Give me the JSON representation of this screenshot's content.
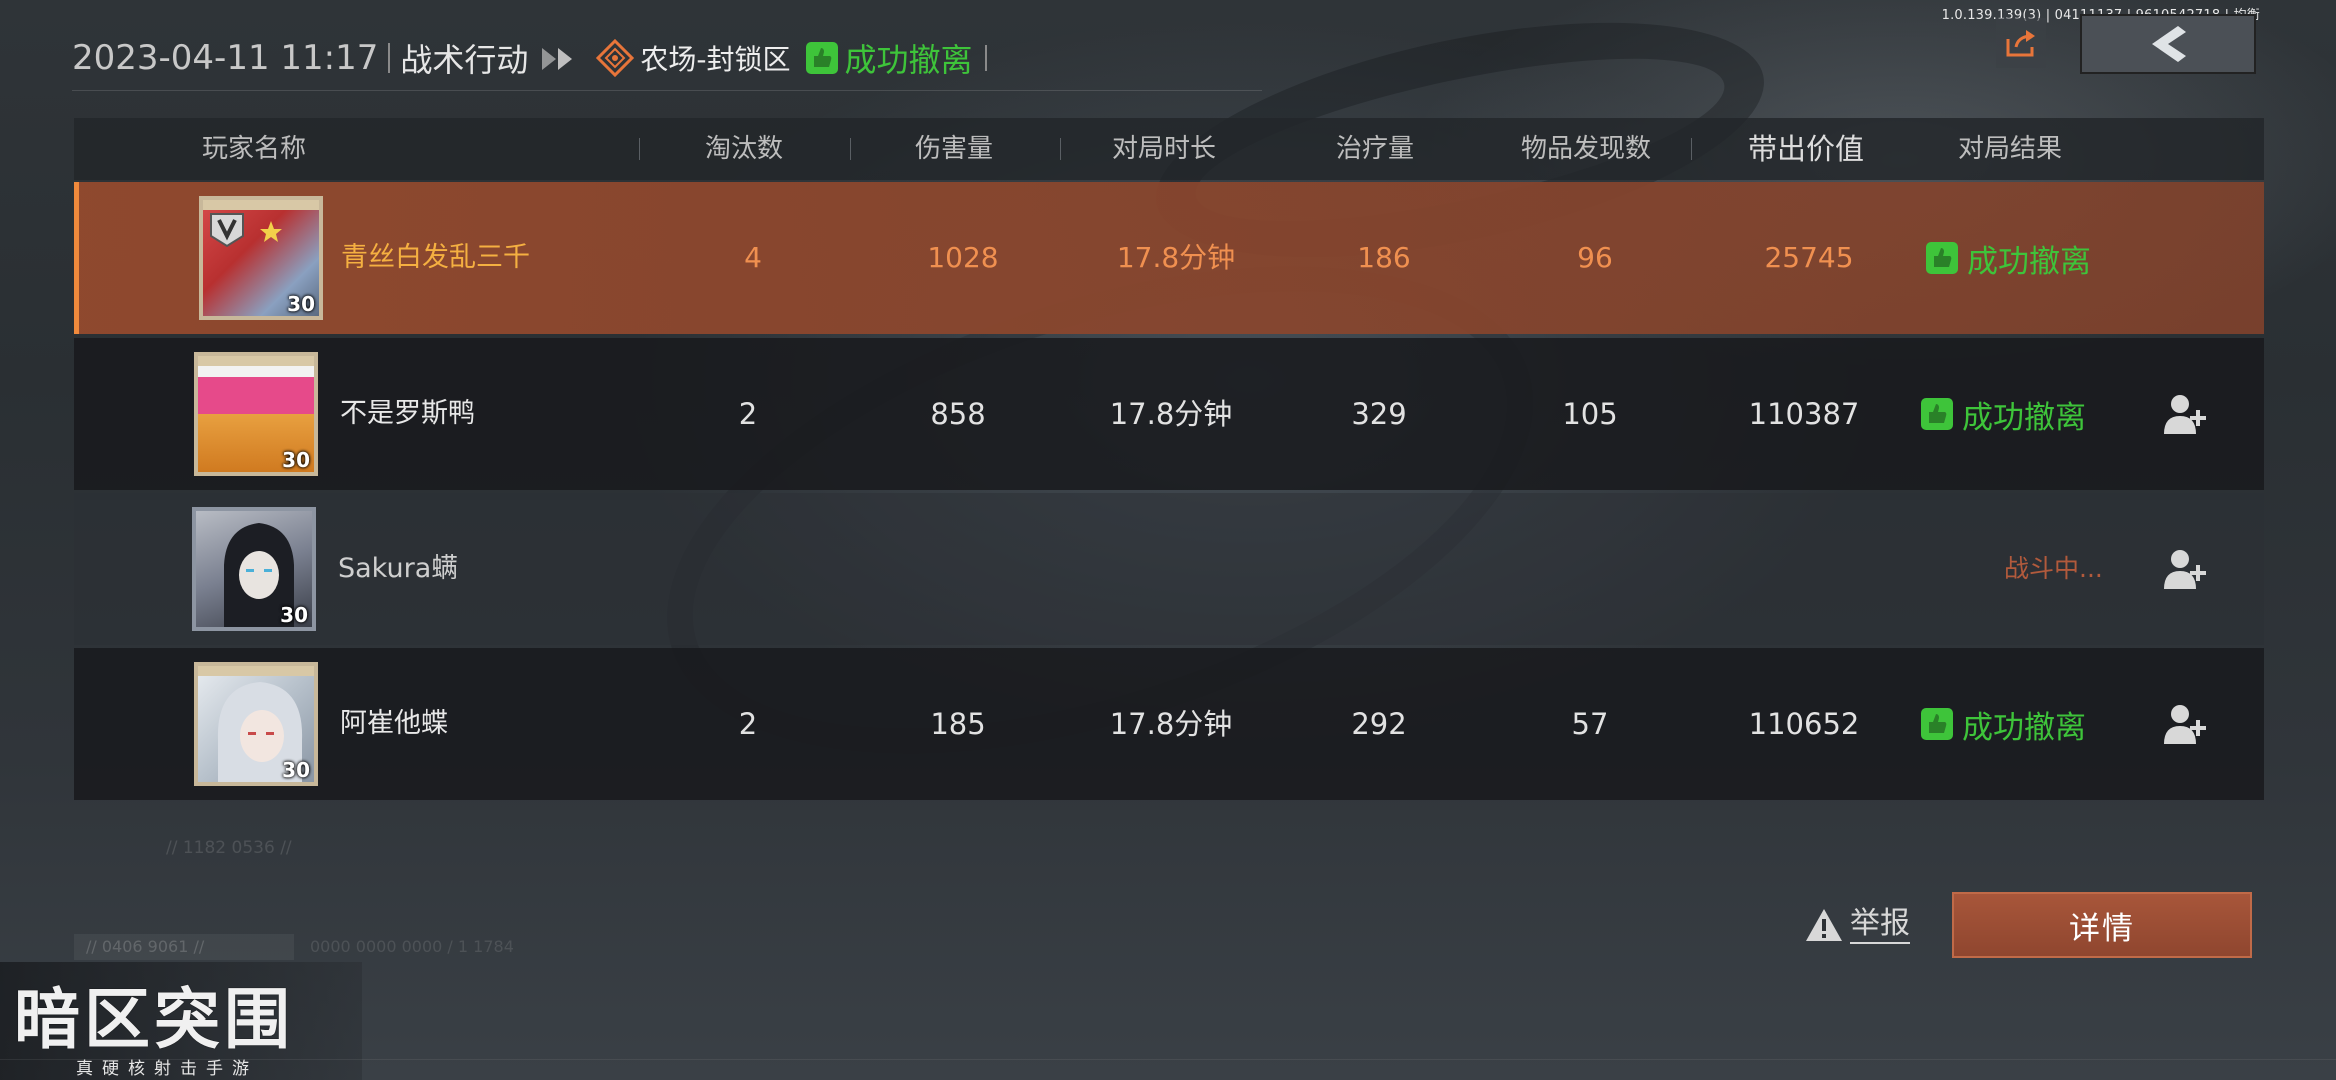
{
  "version_text": "1.0.139.139(3) | 04111137 | 9610542718 | 均衡",
  "header": {
    "datetime": "2023-04-11 11:17",
    "mode": "战术行动",
    "map": "农场-封锁区",
    "result": "成功撤离"
  },
  "table": {
    "columns": [
      "玩家名称",
      "淘汰数",
      "伤害量",
      "对局时长",
      "治疗量",
      "物品发现数",
      "带出价值",
      "对局结果"
    ],
    "rows": [
      {
        "name": "青丝白发乱三千",
        "level": "30",
        "eliminations": "4",
        "damage": "1028",
        "duration": "17.8分钟",
        "healing": "186",
        "items": "96",
        "value": "25745",
        "result": "成功撤离"
      },
      {
        "name": "不是罗斯鸭",
        "level": "30",
        "eliminations": "2",
        "damage": "858",
        "duration": "17.8分钟",
        "healing": "329",
        "items": "105",
        "value": "110387",
        "result": "成功撤离"
      },
      {
        "name": "Sakura螨",
        "level": "30",
        "status": "战斗中..."
      },
      {
        "name": "阿崔他蝶",
        "level": "30",
        "eliminations": "2",
        "damage": "185",
        "duration": "17.8分钟",
        "healing": "292",
        "items": "57",
        "value": "110652",
        "result": "成功撤离"
      }
    ]
  },
  "ghost_text": {
    "code": "// 1182 0536 //",
    "tag": "// 0406 9061 //",
    "line": "0000 0000 0000 / 1 1784"
  },
  "buttons": {
    "report": "举报",
    "detail": "详情"
  },
  "logo": {
    "main": "暗区突围",
    "sub": "真硬核射击手游"
  },
  "colors": {
    "success_green": "#3ec43a",
    "highlight_row": "#944a2e",
    "accent_orange": "#f08a3c",
    "detail_button": "#a8563a",
    "fighting_text": "#b25a3c"
  },
  "icons": [
    "share-icon",
    "back-arrow-icon",
    "map-marker-icon",
    "success-hand-icon",
    "warning-icon",
    "add-friend-icon"
  ]
}
